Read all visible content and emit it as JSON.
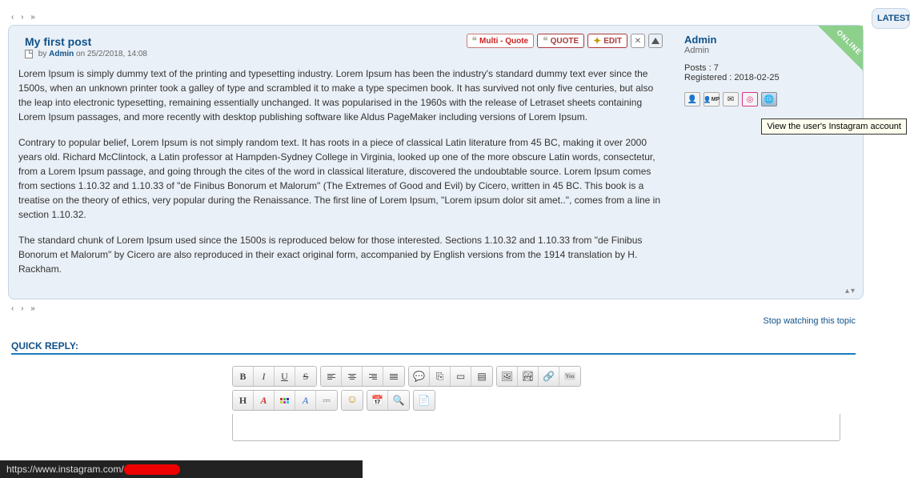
{
  "post": {
    "title": "My first post",
    "by_label": "by",
    "author": "Admin",
    "date": "25/2/2018, 14:08",
    "on_label": "on",
    "body": {
      "p1": "Lorem Ipsum is simply dummy text of the printing and typesetting industry. Lorem Ipsum has been the industry's standard dummy text ever since the 1500s, when an unknown printer took a galley of type and scrambled it to make a type specimen book. It has survived not only five centuries, but also the leap into electronic typesetting, remaining essentially unchanged. It was popularised in the 1960s with the release of Letraset sheets containing Lorem Ipsum passages, and more recently with desktop publishing software like Aldus PageMaker including versions of Lorem Ipsum.",
      "p2": "Contrary to popular belief, Lorem Ipsum is not simply random text. It has roots in a piece of classical Latin literature from 45 BC, making it over 2000 years old. Richard McClintock, a Latin professor at Hampden-Sydney College in Virginia, looked up one of the more obscure Latin words, consectetur, from a Lorem Ipsum passage, and going through the cites of the word in classical literature, discovered the undoubtable source. Lorem Ipsum comes from sections 1.10.32 and 1.10.33 of \"de Finibus Bonorum et Malorum\" (The Extremes of Good and Evil) by Cicero, written in 45 BC. This book is a treatise on the theory of ethics, very popular during the Renaissance. The first line of Lorem Ipsum, \"Lorem ipsum dolor sit amet..\", comes from a line in section 1.10.32.",
      "p3": "The standard chunk of Lorem Ipsum used since the 1500s is reproduced below for those interested. Sections 1.10.32 and 1.10.33 from \"de Finibus Bonorum et Malorum\" by Cicero are also reproduced in their exact original form, accompanied by English versions from the 1914 translation by H. Rackham."
    }
  },
  "actions": {
    "multi_quote": "Multi - Quote",
    "quote": "QUOTE",
    "edit": "EDIT",
    "delete_symbol": "✕",
    "warn_symbol": "⚠"
  },
  "profile": {
    "online": "ONLINE",
    "name": "Admin",
    "rank": "Admin",
    "posts_label": "Posts :",
    "posts": "7",
    "reg_label": "Registered :",
    "reg_date": "2018-02-25",
    "icons": {
      "profile": "👤",
      "pm": "MP",
      "email": "✉",
      "instagram": "◎",
      "www": "🌐"
    }
  },
  "tooltip": "View the user's Instagram account",
  "stop_watch": "Stop watching this topic",
  "quick_reply": "QUICK REPLY:",
  "sidebar": {
    "latest": "LATEST"
  },
  "toolbar": {
    "bold": "B",
    "italic": "I",
    "underline": "U",
    "strike": "S",
    "header": "H",
    "fontcol": "A",
    "smile": "☺",
    "date": "📅",
    "host": "⌂",
    "page": "📄",
    "quote": "💬",
    "code": "{ }",
    "insimg": "🖼",
    "link": "🔗",
    "yt": "You"
  },
  "status_url": "https://www.instagram.com/"
}
